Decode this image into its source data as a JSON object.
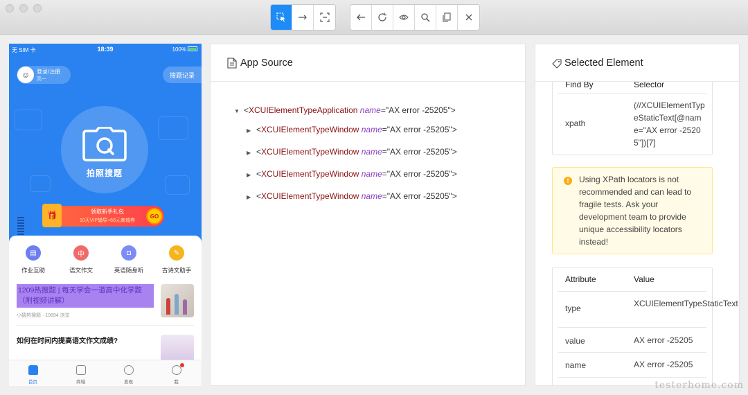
{
  "toolbar": {
    "group1": [
      "select-element",
      "swipe",
      "tap-by-coordinates"
    ],
    "group2": [
      "back",
      "refresh",
      "show-hide",
      "search",
      "copy-xml",
      "quit-session"
    ]
  },
  "phone": {
    "status": {
      "carrier": "无 SIM 卡 ",
      "time": "18:39",
      "battery": "100%"
    },
    "login": {
      "label": "登录/注册",
      "grade": "高一"
    },
    "history_button": "搜题记录",
    "camera_label": "拍照搜题",
    "promo": {
      "line1": "领取新手礼包",
      "line2": "10天VIP辅导+66元商城券",
      "go": "GO"
    },
    "features": [
      {
        "label": "作业互助",
        "icon": "homework-icon",
        "color": "#6b7ff0",
        "glyph": "▤"
      },
      {
        "label": "语文作文",
        "icon": "chinese-icon",
        "color": "#f06a6a",
        "glyph": "中"
      },
      {
        "label": "英语随身听",
        "icon": "english-icon",
        "color": "#7b8cf5",
        "glyph": "◘"
      },
      {
        "label": "古诗文助手",
        "icon": "poetry-icon",
        "color": "#f5b51d",
        "glyph": "✎"
      }
    ],
    "articles": [
      {
        "title": "1209热搜题 | 每天学会一道高中化学题（附视频讲解）",
        "meta": "小猿热搜题 · 10894 浏览"
      },
      {
        "title": "如何在时间内提高语文作文成绩?"
      }
    ],
    "tabs": [
      "首页",
      "商城",
      "发现",
      "我"
    ]
  },
  "source_panel": {
    "title": "App Source",
    "tree": [
      {
        "tag": "XCUIElementTypeApplication",
        "attr": "name",
        "value": "\"AX error -25205\"",
        "expanded": true
      },
      {
        "tag": "XCUIElementTypeWindow",
        "attr": "name",
        "value": "\"AX error -25205\"",
        "expanded": false
      },
      {
        "tag": "XCUIElementTypeWindow",
        "attr": "name",
        "value": "\"AX error -25205\"",
        "expanded": false
      },
      {
        "tag": "XCUIElementTypeWindow",
        "attr": "name",
        "value": "\"AX error -25205\"",
        "expanded": false
      },
      {
        "tag": "XCUIElementTypeWindow",
        "attr": "name",
        "value": "\"AX error -25205\"",
        "expanded": false
      }
    ]
  },
  "selected_panel": {
    "title": "Selected Element",
    "findby": {
      "col1": "Find By",
      "col2": "Selector",
      "strategy": "xpath",
      "selector": "(//XCUIElementTypeStaticText[@name=\"AX error -25205\"])[7]"
    },
    "warning": "Using XPath locators is not recommended and can lead to fragile tests. Ask your development team to provide unique accessibility locators instead!",
    "attributes": {
      "col1": "Attribute",
      "col2": "Value",
      "rows": [
        {
          "name": "type",
          "value": "XCUIElementTypeStaticText"
        },
        {
          "name": "value",
          "value": "AX error -25205"
        },
        {
          "name": "name",
          "value": "AX error -25205"
        }
      ]
    }
  },
  "watermark": "testerhome.com"
}
